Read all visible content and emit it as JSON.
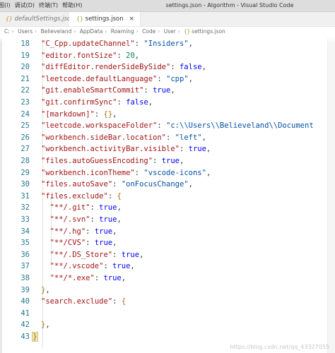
{
  "titlebar": {
    "menu": [
      "图(I)",
      "调试(D)",
      "终端(T)",
      "帮助(H)"
    ],
    "title": "settings.json - Algorithm - Visual Studio Code"
  },
  "tabs": [
    {
      "label": "defaultSettings.json",
      "icon": "json-braces-icon",
      "active": false
    },
    {
      "label": "settings.json",
      "icon": "json-braces-icon",
      "active": true,
      "close": "×"
    }
  ],
  "breadcrumb": [
    "C:",
    "Users",
    "Believeland",
    "AppData",
    "Roaming",
    "Code",
    "User",
    "settings.json"
  ],
  "editor": {
    "lines": [
      {
        "no": "18",
        "tokens": [
          [
            "s",
            "\"C_Cpp.updateChannel\""
          ],
          [
            "p",
            ": "
          ],
          [
            "k",
            "\"Insiders\""
          ],
          [
            "p",
            ","
          ]
        ]
      },
      {
        "no": "19",
        "tokens": [
          [
            "s",
            "\"editor.fontSize\""
          ],
          [
            "p",
            ": "
          ],
          [
            "n",
            "20"
          ],
          [
            "p",
            ","
          ]
        ]
      },
      {
        "no": "20",
        "tokens": [
          [
            "s",
            "\"diffEditor.renderSideBySide\""
          ],
          [
            "p",
            ": "
          ],
          [
            "b",
            "false"
          ],
          [
            "p",
            ","
          ]
        ]
      },
      {
        "no": "21",
        "tokens": [
          [
            "s",
            "\"leetcode.defaultLanguage\""
          ],
          [
            "p",
            ": "
          ],
          [
            "k",
            "\"cpp\""
          ],
          [
            "p",
            ","
          ]
        ]
      },
      {
        "no": "22",
        "tokens": [
          [
            "s",
            "\"git.enableSmartCommit\""
          ],
          [
            "p",
            ": "
          ],
          [
            "b",
            "true"
          ],
          [
            "p",
            ","
          ]
        ]
      },
      {
        "no": "23",
        "tokens": [
          [
            "s",
            "\"git.confirmSync\""
          ],
          [
            "p",
            ": "
          ],
          [
            "b",
            "false"
          ],
          [
            "p",
            ","
          ]
        ]
      },
      {
        "no": "24",
        "tokens": [
          [
            "s",
            "\"[markdown]\""
          ],
          [
            "p",
            ": "
          ],
          [
            "brc",
            "{}"
          ],
          [
            "p",
            ","
          ]
        ]
      },
      {
        "no": "25",
        "tokens": [
          [
            "s",
            "\"leetcode.workspaceFolder\""
          ],
          [
            "p",
            ": "
          ],
          [
            "k",
            "\"c:\\\\Users\\\\Believeland\\\\Document"
          ]
        ]
      },
      {
        "no": "26",
        "tokens": [
          [
            "s",
            "\"workbench.sideBar.location\""
          ],
          [
            "p",
            ": "
          ],
          [
            "k",
            "\"left\""
          ],
          [
            "p",
            ","
          ]
        ]
      },
      {
        "no": "27",
        "tokens": [
          [
            "s",
            "\"workbench.activityBar.visible\""
          ],
          [
            "p",
            ": "
          ],
          [
            "b",
            "true"
          ],
          [
            "p",
            ","
          ]
        ]
      },
      {
        "no": "28",
        "tokens": [
          [
            "s",
            "\"files.autoGuessEncoding\""
          ],
          [
            "p",
            ": "
          ],
          [
            "b",
            "true"
          ],
          [
            "p",
            ","
          ]
        ]
      },
      {
        "no": "29",
        "tokens": [
          [
            "s",
            "\"workbench.iconTheme\""
          ],
          [
            "p",
            ": "
          ],
          [
            "k",
            "\"vscode-icons\""
          ],
          [
            "p",
            ","
          ]
        ]
      },
      {
        "no": "30",
        "tokens": [
          [
            "s",
            "\"files.autoSave\""
          ],
          [
            "p",
            ": "
          ],
          [
            "k",
            "\"onFocusChange\""
          ],
          [
            "p",
            ","
          ]
        ]
      },
      {
        "no": "31",
        "tokens": [
          [
            "s",
            "\"files.exclude\""
          ],
          [
            "p",
            ": "
          ],
          [
            "brc",
            "{"
          ]
        ]
      },
      {
        "no": "32",
        "indent": 2,
        "tokens": [
          [
            "s",
            "\"**/.git\""
          ],
          [
            "p",
            ": "
          ],
          [
            "b",
            "true"
          ],
          [
            "p",
            ","
          ]
        ]
      },
      {
        "no": "33",
        "indent": 2,
        "tokens": [
          [
            "s",
            "\"**/.svn\""
          ],
          [
            "p",
            ": "
          ],
          [
            "b",
            "true"
          ],
          [
            "p",
            ","
          ]
        ]
      },
      {
        "no": "34",
        "indent": 2,
        "tokens": [
          [
            "s",
            "\"**/.hg\""
          ],
          [
            "p",
            ": "
          ],
          [
            "b",
            "true"
          ],
          [
            "p",
            ","
          ]
        ]
      },
      {
        "no": "35",
        "indent": 2,
        "tokens": [
          [
            "s",
            "\"**/CVS\""
          ],
          [
            "p",
            ": "
          ],
          [
            "b",
            "true"
          ],
          [
            "p",
            ","
          ]
        ]
      },
      {
        "no": "36",
        "indent": 2,
        "tokens": [
          [
            "s",
            "\"**/.DS_Store\""
          ],
          [
            "p",
            ": "
          ],
          [
            "b",
            "true"
          ],
          [
            "p",
            ","
          ]
        ]
      },
      {
        "no": "37",
        "indent": 2,
        "tokens": [
          [
            "s",
            "\"**/.vscode\""
          ],
          [
            "p",
            ": "
          ],
          [
            "b",
            "true"
          ],
          [
            "p",
            ","
          ]
        ]
      },
      {
        "no": "38",
        "indent": 2,
        "tokens": [
          [
            "s",
            "\"**/*.exe\""
          ],
          [
            "p",
            ": "
          ],
          [
            "b",
            "true"
          ],
          [
            "p",
            ","
          ]
        ]
      },
      {
        "no": "39",
        "tokens": [
          [
            "brc",
            "}"
          ],
          [
            "p",
            ","
          ]
        ]
      },
      {
        "no": "40",
        "tokens": [
          [
            "s",
            "\"search.exclude\""
          ],
          [
            "p",
            ": "
          ],
          [
            "brc",
            "{"
          ]
        ]
      },
      {
        "no": "41",
        "tokens": []
      },
      {
        "no": "42",
        "tokens": [
          [
            "brc",
            "}"
          ],
          [
            "p",
            ","
          ]
        ]
      },
      {
        "no": "43",
        "indent": -2,
        "tokens": [
          [
            "cur",
            "}"
          ]
        ]
      }
    ]
  },
  "watermark": "https://blog.csdn.net/qq_43327055",
  "colors": {
    "string_key": "#a31515",
    "string_value": "#0451a5",
    "boolean": "#0000ff",
    "number": "#098658",
    "line_number": "#237893"
  }
}
